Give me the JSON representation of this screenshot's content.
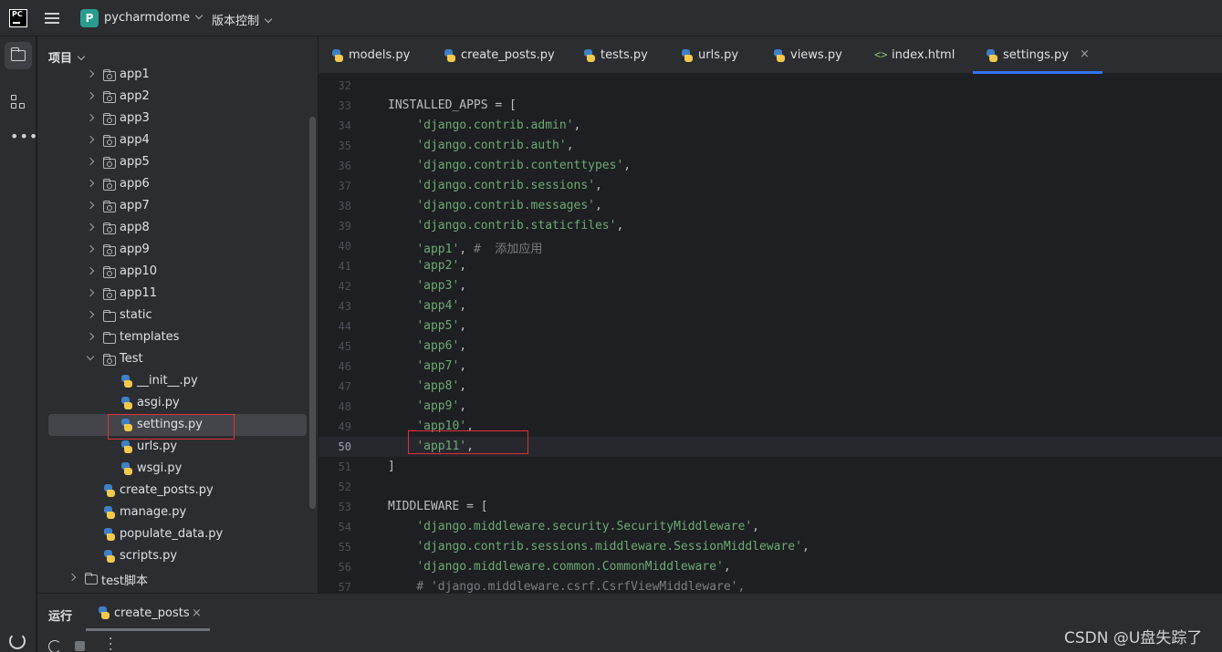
{
  "titlebar": {
    "logo_text": "PC",
    "project_badge": "P",
    "project_name": "pycharmdome",
    "vcs_label": "版本控制"
  },
  "project_panel": {
    "title": "项目",
    "items": [
      {
        "label": "app1",
        "type": "package",
        "level": 1
      },
      {
        "label": "app2",
        "type": "package",
        "level": 1
      },
      {
        "label": "app3",
        "type": "package",
        "level": 1
      },
      {
        "label": "app4",
        "type": "package",
        "level": 1
      },
      {
        "label": "app5",
        "type": "package",
        "level": 1
      },
      {
        "label": "app6",
        "type": "package",
        "level": 1
      },
      {
        "label": "app7",
        "type": "package",
        "level": 1
      },
      {
        "label": "app8",
        "type": "package",
        "level": 1
      },
      {
        "label": "app9",
        "type": "package",
        "level": 1
      },
      {
        "label": "app10",
        "type": "package",
        "level": 1
      },
      {
        "label": "app11",
        "type": "package",
        "level": 1
      },
      {
        "label": "static",
        "type": "folder",
        "level": 1
      },
      {
        "label": "templates",
        "type": "folder",
        "level": 1
      },
      {
        "label": "Test",
        "type": "package-open",
        "level": 1
      },
      {
        "label": "__init__.py",
        "type": "py",
        "level": 2
      },
      {
        "label": "asgi.py",
        "type": "py",
        "level": 2
      },
      {
        "label": "settings.py",
        "type": "py",
        "level": 2,
        "selected": true
      },
      {
        "label": "urls.py",
        "type": "py",
        "level": 2
      },
      {
        "label": "wsgi.py",
        "type": "py",
        "level": 2
      },
      {
        "label": "create_posts.py",
        "type": "py",
        "level": 1
      },
      {
        "label": "manage.py",
        "type": "py",
        "level": 1
      },
      {
        "label": "populate_data.py",
        "type": "py",
        "level": 1
      },
      {
        "label": "scripts.py",
        "type": "py",
        "level": 1
      },
      {
        "label": "test脚本",
        "type": "folder",
        "level": 0
      }
    ]
  },
  "tabs": [
    {
      "label": "models.py",
      "icon": "python-icon"
    },
    {
      "label": "create_posts.py",
      "icon": "python-icon"
    },
    {
      "label": "tests.py",
      "icon": "python-icon"
    },
    {
      "label": "urls.py",
      "icon": "python-icon"
    },
    {
      "label": "views.py",
      "icon": "python-icon"
    },
    {
      "label": "index.html",
      "icon": "html-icon"
    },
    {
      "label": "settings.py",
      "icon": "python-icon",
      "active": true,
      "close": "×"
    }
  ],
  "html_icon_glyph": "<>",
  "editor": {
    "current_line": 50,
    "lines": [
      {
        "num": "32",
        "parts": []
      },
      {
        "num": "33",
        "parts": [
          {
            "t": "INSTALLED_APPS = [",
            "c": "plain"
          }
        ]
      },
      {
        "num": "34",
        "parts": [
          {
            "t": "    ",
            "c": "plain"
          },
          {
            "t": "'django.contrib.admin'",
            "c": "str"
          },
          {
            "t": ",",
            "c": "plain"
          }
        ]
      },
      {
        "num": "35",
        "parts": [
          {
            "t": "    ",
            "c": "plain"
          },
          {
            "t": "'django.contrib.auth'",
            "c": "str"
          },
          {
            "t": ",",
            "c": "plain"
          }
        ]
      },
      {
        "num": "36",
        "parts": [
          {
            "t": "    ",
            "c": "plain"
          },
          {
            "t": "'django.contrib.contenttypes'",
            "c": "str"
          },
          {
            "t": ",",
            "c": "plain"
          }
        ]
      },
      {
        "num": "37",
        "parts": [
          {
            "t": "    ",
            "c": "plain"
          },
          {
            "t": "'django.contrib.sessions'",
            "c": "str"
          },
          {
            "t": ",",
            "c": "plain"
          }
        ]
      },
      {
        "num": "38",
        "parts": [
          {
            "t": "    ",
            "c": "plain"
          },
          {
            "t": "'django.contrib.messages'",
            "c": "str"
          },
          {
            "t": ",",
            "c": "plain"
          }
        ]
      },
      {
        "num": "39",
        "parts": [
          {
            "t": "    ",
            "c": "plain"
          },
          {
            "t": "'django.contrib.staticfiles'",
            "c": "str"
          },
          {
            "t": ",",
            "c": "plain"
          }
        ]
      },
      {
        "num": "40",
        "parts": [
          {
            "t": "    ",
            "c": "plain"
          },
          {
            "t": "'app1'",
            "c": "str"
          },
          {
            "t": ", ",
            "c": "plain"
          },
          {
            "t": "#  添加应用",
            "c": "cmt"
          }
        ]
      },
      {
        "num": "41",
        "parts": [
          {
            "t": "    ",
            "c": "plain"
          },
          {
            "t": "'app2'",
            "c": "str"
          },
          {
            "t": ",",
            "c": "plain"
          }
        ]
      },
      {
        "num": "42",
        "parts": [
          {
            "t": "    ",
            "c": "plain"
          },
          {
            "t": "'app3'",
            "c": "str"
          },
          {
            "t": ",",
            "c": "plain"
          }
        ]
      },
      {
        "num": "43",
        "parts": [
          {
            "t": "    ",
            "c": "plain"
          },
          {
            "t": "'app4'",
            "c": "str"
          },
          {
            "t": ",",
            "c": "plain"
          }
        ]
      },
      {
        "num": "44",
        "parts": [
          {
            "t": "    ",
            "c": "plain"
          },
          {
            "t": "'app5'",
            "c": "str"
          },
          {
            "t": ",",
            "c": "plain"
          }
        ]
      },
      {
        "num": "45",
        "parts": [
          {
            "t": "    ",
            "c": "plain"
          },
          {
            "t": "'app6'",
            "c": "str"
          },
          {
            "t": ",",
            "c": "plain"
          }
        ]
      },
      {
        "num": "46",
        "parts": [
          {
            "t": "    ",
            "c": "plain"
          },
          {
            "t": "'app7'",
            "c": "str"
          },
          {
            "t": ",",
            "c": "plain"
          }
        ]
      },
      {
        "num": "47",
        "parts": [
          {
            "t": "    ",
            "c": "plain"
          },
          {
            "t": "'app8'",
            "c": "str"
          },
          {
            "t": ",",
            "c": "plain"
          }
        ]
      },
      {
        "num": "48",
        "parts": [
          {
            "t": "    ",
            "c": "plain"
          },
          {
            "t": "'app9'",
            "c": "str"
          },
          {
            "t": ",",
            "c": "plain"
          }
        ]
      },
      {
        "num": "49",
        "parts": [
          {
            "t": "    ",
            "c": "plain"
          },
          {
            "t": "'app10'",
            "c": "str"
          },
          {
            "t": ",",
            "c": "plain"
          }
        ]
      },
      {
        "num": "50",
        "parts": [
          {
            "t": "    ",
            "c": "plain"
          },
          {
            "t": "'app11'",
            "c": "str"
          },
          {
            "t": ",",
            "c": "plain"
          }
        ]
      },
      {
        "num": "51",
        "parts": [
          {
            "t": "]",
            "c": "plain"
          }
        ]
      },
      {
        "num": "52",
        "parts": []
      },
      {
        "num": "53",
        "parts": [
          {
            "t": "MIDDLEWARE = [",
            "c": "plain"
          }
        ]
      },
      {
        "num": "54",
        "parts": [
          {
            "t": "    ",
            "c": "plain"
          },
          {
            "t": "'django.middleware.security.SecurityMiddleware'",
            "c": "str"
          },
          {
            "t": ",",
            "c": "plain"
          }
        ]
      },
      {
        "num": "55",
        "parts": [
          {
            "t": "    ",
            "c": "plain"
          },
          {
            "t": "'django.contrib.sessions.middleware.SessionMiddleware'",
            "c": "str"
          },
          {
            "t": ",",
            "c": "plain"
          }
        ]
      },
      {
        "num": "56",
        "parts": [
          {
            "t": "    ",
            "c": "plain"
          },
          {
            "t": "'django.middleware.common.CommonMiddleware'",
            "c": "str"
          },
          {
            "t": ",",
            "c": "plain"
          }
        ]
      },
      {
        "num": "57",
        "parts": [
          {
            "t": "    # 'django.middleware.csrf.CsrfViewMiddleware',",
            "c": "cmt"
          }
        ]
      }
    ]
  },
  "run_panel": {
    "title": "运行",
    "tab_label": "create_posts",
    "tab_close": "×"
  },
  "watermark": "CSDN @U盘失踪了",
  "colors": {
    "string": "#6aab73",
    "comment": "#7a7e85",
    "accent": "#3574f0",
    "highlight_box": "#e0303a"
  }
}
